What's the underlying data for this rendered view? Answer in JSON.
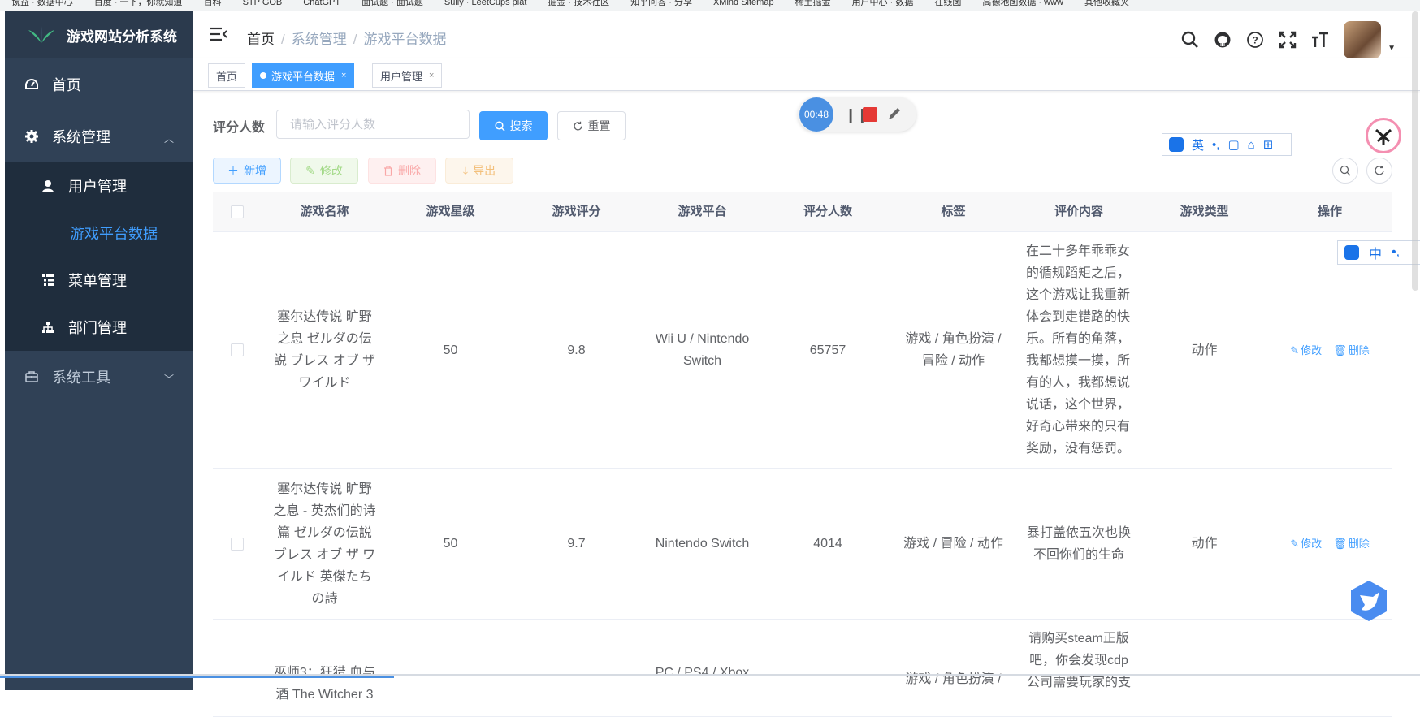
{
  "bookmarks": [
    "镜益 · 数据中心",
    "百度 · 一下，你就知道",
    "百科",
    "STP GOB",
    "ChatGPT",
    "面试题 · 面试题",
    "Sully · LeetCups plat",
    "掘金 · 技术社区",
    "知乎问答 · 分享",
    "XMind Sitemap",
    "稀土掘金",
    "用户中心 · 数据",
    "在线图",
    "高德地图数据 · www",
    "其他收藏夹"
  ],
  "app_title": "游戏网站分析系统",
  "sidebar": {
    "home": "首页",
    "system": "系统管理",
    "submenu": [
      "用户管理",
      "游戏平台数据",
      "菜单管理",
      "部门管理"
    ],
    "tools": "系统工具"
  },
  "breadcrumb": [
    "首页",
    "系统管理",
    "游戏平台数据"
  ],
  "tabs": [
    {
      "label": "首页"
    },
    {
      "label": "游戏平台数据",
      "close": "×"
    },
    {
      "label": "用户管理",
      "close": "×"
    }
  ],
  "search": {
    "label": "评分人数",
    "placeholder": "请输入评分人数",
    "search_btn": "搜索",
    "reset_btn": "重置"
  },
  "toolbar": {
    "add": "新增",
    "edit": "修改",
    "delete": "删除",
    "export": "导出"
  },
  "columns": [
    "游戏名称",
    "游戏星级",
    "游戏评分",
    "游戏平台",
    "评分人数",
    "标签",
    "评价内容",
    "游戏类型",
    "操作"
  ],
  "rows": [
    {
      "name": "塞尔达传说 旷野之息 ゼルダの伝説 ブレス オブ ザ ワイルド",
      "stars": "50",
      "score": "9.8",
      "platform": "Wii U / Nintendo Switch",
      "raters": "65757",
      "tags": "游戏 / 角色扮演 / 冒险 / 动作",
      "review": "在二十多年乖乖女的循规蹈矩之后，这个游戏让我重新体会到走错路的快乐。所有的角落，我都想摸一摸，所有的人，我都想说说话，这个世界，好奇心带来的只有奖励，没有惩罚。",
      "type": "动作"
    },
    {
      "name": "塞尔达传说 旷野之息 - 英杰们的诗篇 ゼルダの伝説 ブレス オブ ザ ワイルド 英傑たちの詩",
      "stars": "50",
      "score": "9.7",
      "platform": "Nintendo Switch",
      "raters": "4014",
      "tags": "游戏 / 冒险 / 动作",
      "review": "暴打盖侬五次也换不回你们的生命",
      "type": "动作"
    },
    {
      "name": "巫师3：狂猎 血与酒 The Witcher 3",
      "stars": "",
      "score": "",
      "platform": "PC / PS4 / Xbox",
      "raters": "",
      "tags": "游戏 / 角色扮演 /",
      "review": "请购买steam正版吧，你会发现cdp公司需要玩家的支",
      "type": ""
    }
  ],
  "actions": {
    "edit": "修改",
    "delete": "删除"
  },
  "recorder": {
    "time": "00:48"
  },
  "ime": {
    "top": "英",
    "side": "中"
  }
}
